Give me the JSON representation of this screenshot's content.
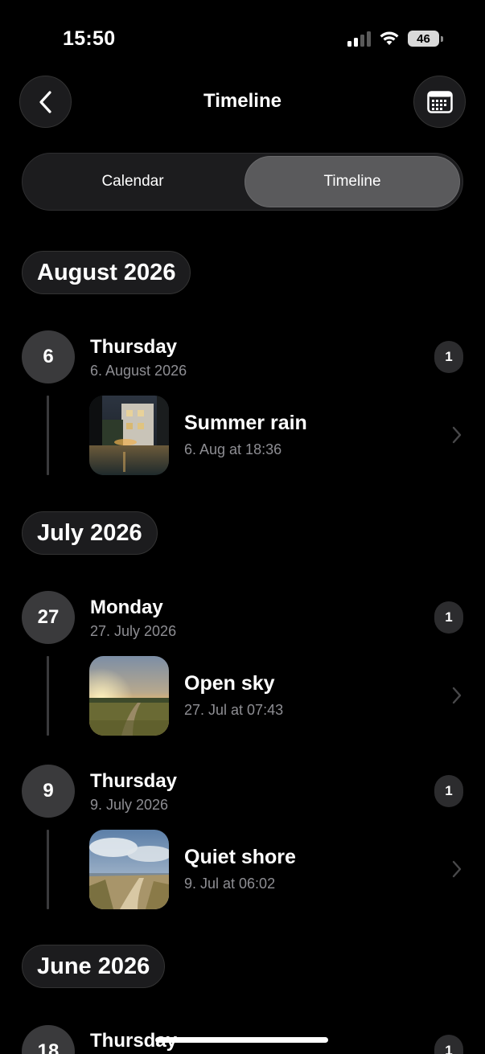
{
  "status_bar": {
    "time": "15:50",
    "battery": "46"
  },
  "header": {
    "title": "Timeline",
    "back_icon": "chevron-left-icon",
    "calendar_icon": "calendar-grid-icon"
  },
  "segmented": {
    "options": [
      "Calendar",
      "Timeline"
    ],
    "selected": "Timeline"
  },
  "months": [
    {
      "label": "August 2026",
      "days": [
        {
          "day": "6",
          "weekday": "Thursday",
          "date": "6. August 2026",
          "count": "1",
          "entries": [
            {
              "title": "Summer rain",
              "subtitle": "6. Aug at 18:36",
              "thumb": "rainy-street-photo"
            }
          ]
        }
      ]
    },
    {
      "label": "July 2026",
      "days": [
        {
          "day": "27",
          "weekday": "Monday",
          "date": "27. July 2026",
          "count": "1",
          "entries": [
            {
              "title": "Open sky",
              "subtitle": "27. Jul at 07:43",
              "thumb": "sunrise-field-photo"
            }
          ]
        },
        {
          "day": "9",
          "weekday": "Thursday",
          "date": "9. July 2026",
          "count": "1",
          "entries": [
            {
              "title": "Quiet shore",
              "subtitle": "9. Jul at 06:02",
              "thumb": "dune-path-photo"
            }
          ]
        }
      ]
    },
    {
      "label": "June 2026",
      "days": [
        {
          "day": "18",
          "weekday": "Thursday",
          "count": "1"
        }
      ]
    }
  ],
  "colors": {
    "background": "#000000",
    "surface": "#1c1c1e",
    "selected_segment": "#5a5a5c",
    "secondary_text": "#8e8e93"
  }
}
